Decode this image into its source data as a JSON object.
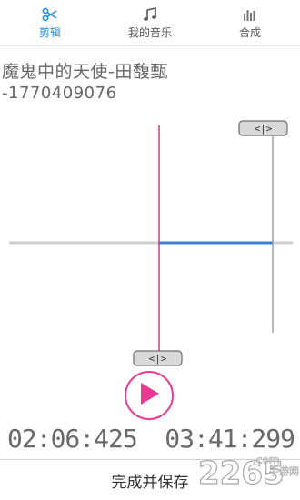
{
  "tabs": [
    {
      "label": "剪辑",
      "icon": "scissors-icon",
      "active": true
    },
    {
      "label": "我的音乐",
      "icon": "music-note-icon",
      "active": false
    },
    {
      "label": "合成",
      "icon": "equalizer-icon",
      "active": false
    }
  ],
  "song": {
    "title": "魔鬼中的天使-田馥甄",
    "id": "-1770409076"
  },
  "editor": {
    "start_time": "02:06:425",
    "end_time": "03:41:299",
    "start_handle_label": "<|>",
    "end_handle_label": "<|>"
  },
  "actions": {
    "save_label": "完成并保存"
  },
  "watermark": {
    "brand": "2265",
    "suffix": ".com",
    "subtitle": "手游网"
  },
  "colors": {
    "accent_blue": "#2f8ed8",
    "accent_pink": "#e83a92",
    "selection_blue": "#3a7fd0"
  }
}
